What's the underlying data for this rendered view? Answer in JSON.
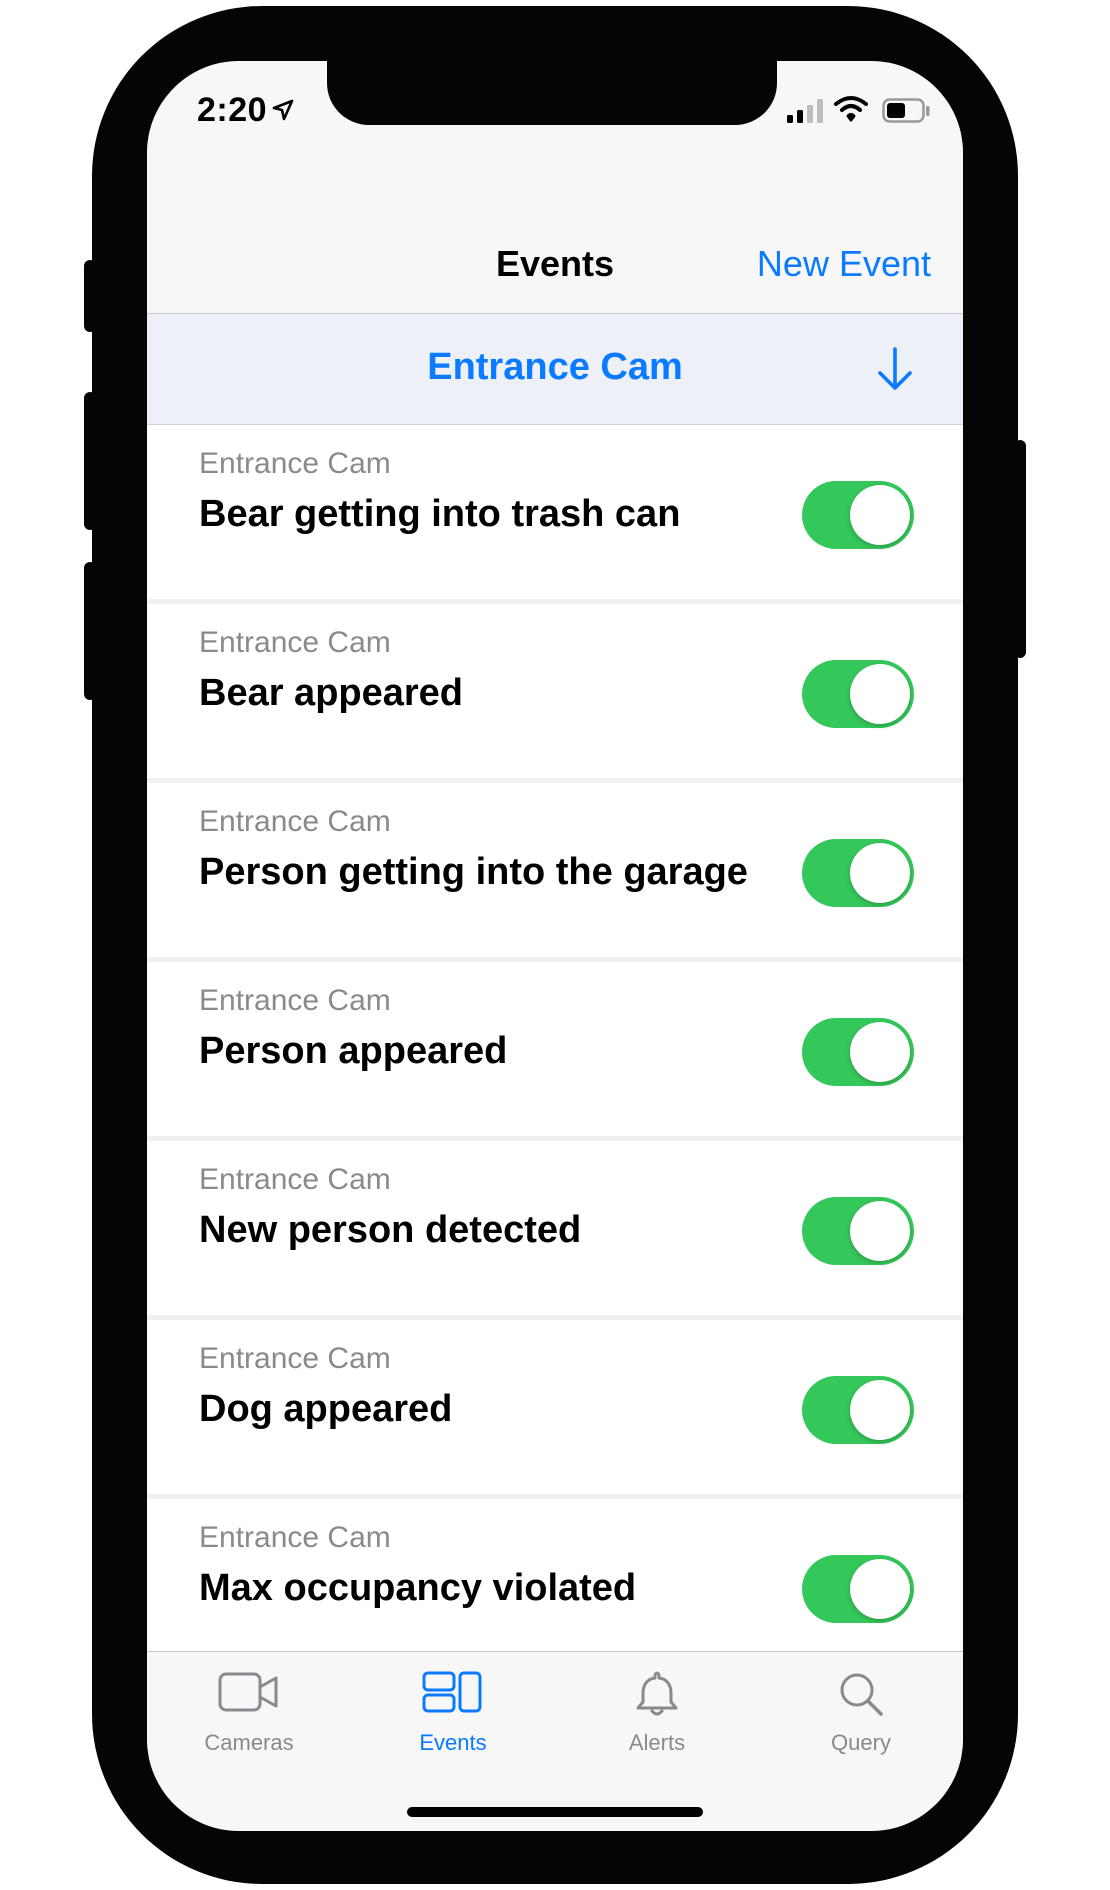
{
  "status_bar": {
    "time": "2:20"
  },
  "nav": {
    "title": "Events",
    "new_event_label": "New Event"
  },
  "camera_selector": {
    "label": "Entrance Cam"
  },
  "events": [
    {
      "camera": "Entrance Cam",
      "name": "Bear getting into trash can",
      "enabled": true
    },
    {
      "camera": "Entrance Cam",
      "name": "Bear appeared",
      "enabled": true
    },
    {
      "camera": "Entrance Cam",
      "name": "Person getting into the garage",
      "enabled": true
    },
    {
      "camera": "Entrance Cam",
      "name": "Person appeared",
      "enabled": true
    },
    {
      "camera": "Entrance Cam",
      "name": "New person detected",
      "enabled": true
    },
    {
      "camera": "Entrance Cam",
      "name": "Dog appeared",
      "enabled": true
    },
    {
      "camera": "Entrance Cam",
      "name": "Max occupancy violated",
      "enabled": true
    }
  ],
  "tabs": [
    {
      "label": "Cameras",
      "icon": "video-camera-icon",
      "active": false
    },
    {
      "label": "Events",
      "icon": "events-grid-icon",
      "active": true
    },
    {
      "label": "Alerts",
      "icon": "bell-icon",
      "active": false
    },
    {
      "label": "Query",
      "icon": "magnifier-icon",
      "active": false
    }
  ],
  "colors": {
    "accent": "#0a7aff",
    "toggle_on": "#34c759",
    "secondary_text": "#8a8a8e"
  }
}
